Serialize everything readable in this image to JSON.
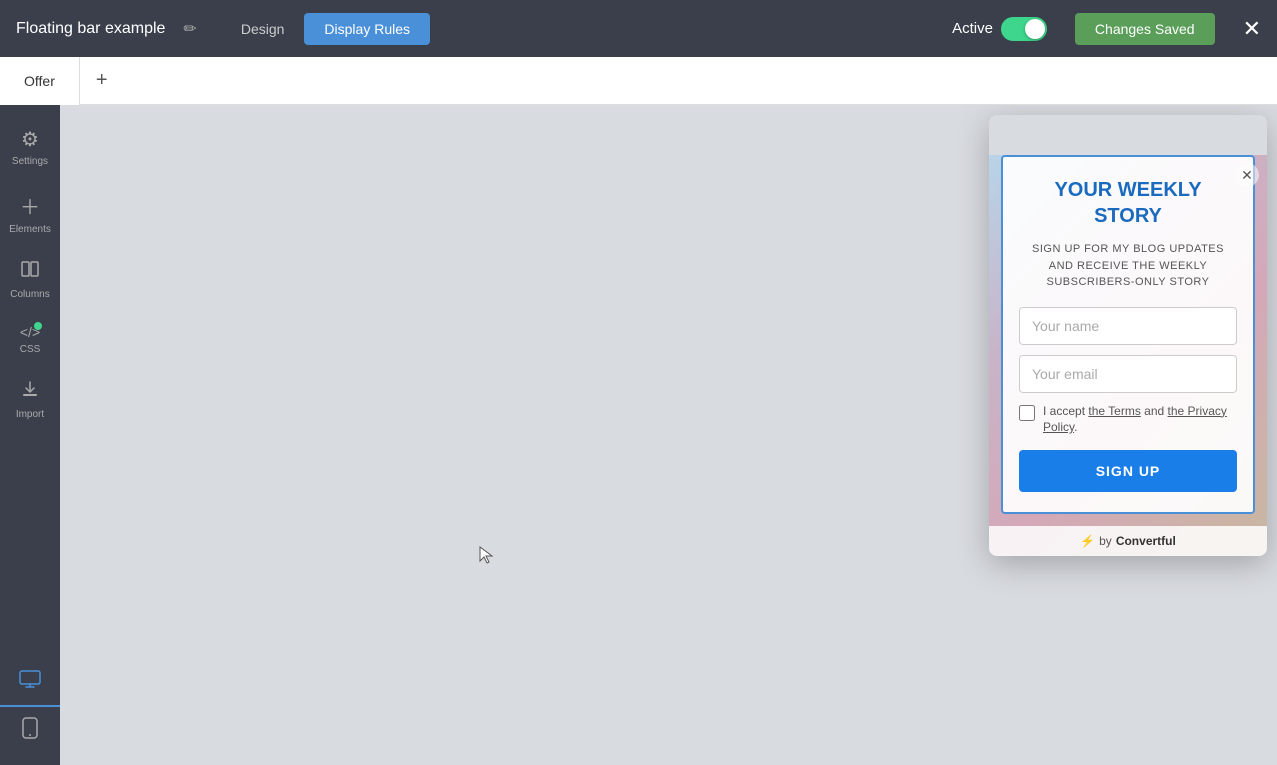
{
  "topbar": {
    "title": "Floating bar example",
    "edit_icon": "✏",
    "tabs": [
      {
        "id": "design",
        "label": "Design",
        "active": false
      },
      {
        "id": "display-rules",
        "label": "Display Rules",
        "active": true
      }
    ],
    "active_label": "Active",
    "toggle_on": true,
    "changes_saved_label": "Changes Saved",
    "close_icon": "✕"
  },
  "tabs_bar": {
    "tabs": [
      {
        "id": "offer",
        "label": "Offer",
        "selected": true
      }
    ],
    "add_icon": "+"
  },
  "sidebar": {
    "items": [
      {
        "id": "settings",
        "icon": "⊞",
        "label": "Settings"
      },
      {
        "id": "elements",
        "icon": "+",
        "label": "Elements"
      },
      {
        "id": "columns",
        "icon": "⬜",
        "label": "Columns"
      },
      {
        "id": "css",
        "icon": "</>",
        "label": "CSS",
        "has_dot": true
      },
      {
        "id": "import",
        "icon": "⬇",
        "label": "Import"
      }
    ],
    "devices": [
      {
        "id": "desktop",
        "icon": "🖥",
        "active": true
      },
      {
        "id": "mobile",
        "icon": "📱",
        "active": false
      }
    ]
  },
  "popup": {
    "title": "YOUR WEEKLY STORY",
    "subtitle": "SIGN UP FOR MY BLOG UPDATES AND RECEIVE THE WEEKLY SUBSCRIBERS-ONLY STORY",
    "name_placeholder": "Your name",
    "email_placeholder": "Your email",
    "checkbox_label_before": "I accept ",
    "terms_link": "the Terms",
    "and_text": " and ",
    "privacy_link": "the Privacy Policy",
    "checkbox_label_after": ".",
    "signup_btn": "SIGN UP",
    "footer_text": "by",
    "footer_brand": "Convertful",
    "footer_icon": "⚡"
  }
}
